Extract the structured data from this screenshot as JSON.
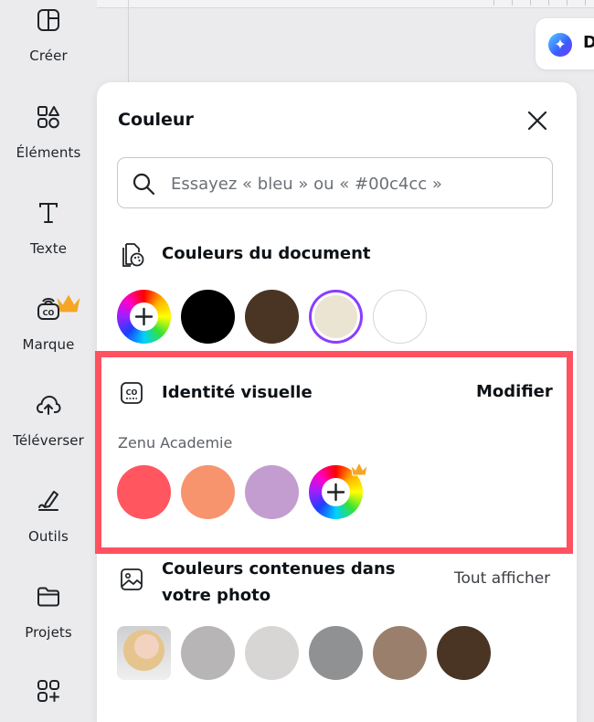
{
  "rail": {
    "items": [
      {
        "label": "Créer",
        "icon": "layout-icon"
      },
      {
        "label": "Éléments",
        "icon": "shapes-icon"
      },
      {
        "label": "Texte",
        "icon": "text-icon"
      },
      {
        "label": "Marque",
        "icon": "brand-kit-icon"
      },
      {
        "label": "Téléverser",
        "icon": "cloud-upload-icon"
      },
      {
        "label": "Outils",
        "icon": "draw-pen-icon"
      },
      {
        "label": "Projets",
        "icon": "folder-icon"
      },
      {
        "label": "",
        "icon": "apps-icon"
      }
    ]
  },
  "assistant": {
    "letter": "D"
  },
  "panel": {
    "title": "Couleur",
    "search_placeholder": "Essayez « bleu » ou « #00c4cc »",
    "document_colors": {
      "title": "Couleurs du document",
      "swatches": [
        "#000000",
        "#4a3424",
        "#ebe4d3",
        "#ffffff"
      ],
      "selected_index": 2
    },
    "brand": {
      "title": "Identité visuelle",
      "action": "Modifier",
      "kit_name": "Zenu Academie",
      "swatches": [
        "#ff5660",
        "#f7936d",
        "#c39dd0"
      ]
    },
    "photo_colors": {
      "title_line1": "Couleurs contenues dans",
      "title_line2": "votre photo",
      "action": "Tout afficher",
      "swatches": [
        "#b7b5b6",
        "#d8d6d5",
        "#909192",
        "#9b7f6d",
        "#4a3424"
      ]
    }
  },
  "colors": {
    "accent": "#8b3dff",
    "highlight": "#ff5160",
    "crown": "#f5a623"
  }
}
